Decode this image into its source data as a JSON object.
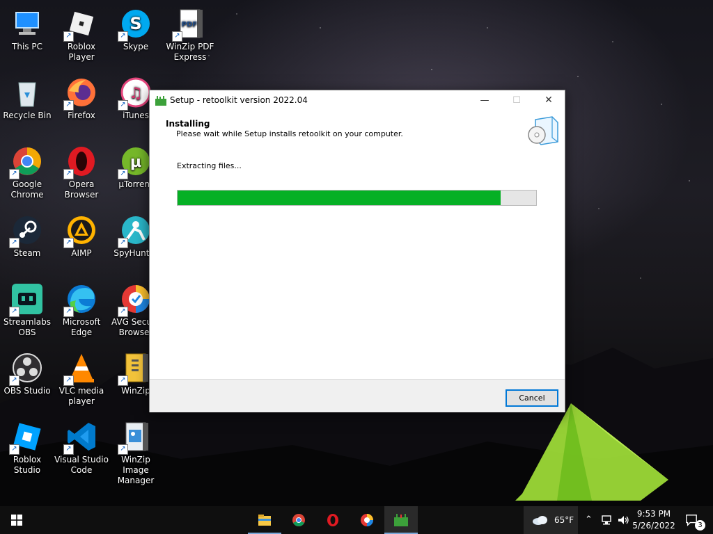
{
  "desktop": {
    "icons": [
      {
        "label": "This PC",
        "icon": "computer-icon"
      },
      {
        "label": "Roblox Player",
        "icon": "roblox-icon"
      },
      {
        "label": "Skype",
        "icon": "skype-icon"
      },
      {
        "label": "WinZip PDF Express",
        "icon": "winzip-pdf-icon"
      },
      {
        "label": "Recycle Bin",
        "icon": "recycle-bin-icon"
      },
      {
        "label": "Firefox",
        "icon": "firefox-icon"
      },
      {
        "label": "iTunes",
        "icon": "itunes-icon"
      },
      {
        "label": "Google Chrome",
        "icon": "chrome-icon"
      },
      {
        "label": "Opera Browser",
        "icon": "opera-icon"
      },
      {
        "label": "µTorrent",
        "icon": "utorrent-icon"
      },
      {
        "label": "Steam",
        "icon": "steam-icon"
      },
      {
        "label": "AIMP",
        "icon": "aimp-icon"
      },
      {
        "label": "SpyHunter",
        "icon": "spyhunter-icon"
      },
      {
        "label": "Streamlabs OBS",
        "icon": "streamlabs-icon"
      },
      {
        "label": "Microsoft Edge",
        "icon": "edge-icon"
      },
      {
        "label": "AVG Secure Browser",
        "icon": "avg-browser-icon"
      },
      {
        "label": "OBS Studio",
        "icon": "obs-icon"
      },
      {
        "label": "VLC media player",
        "icon": "vlc-icon"
      },
      {
        "label": "WinZip",
        "icon": "winzip-icon"
      },
      {
        "label": "Roblox Studio",
        "icon": "roblox-studio-icon"
      },
      {
        "label": "Visual Studio Code",
        "icon": "vscode-icon"
      },
      {
        "label": "WinZip Image Manager",
        "icon": "winzip-image-icon"
      }
    ]
  },
  "dialog": {
    "title": "Setup - retoolkit version 2022.04",
    "heading": "Installing",
    "subheading": "Please wait while Setup installs retoolkit on your computer.",
    "status": "Extracting files...",
    "progress": 0.9,
    "cancel_label": "Cancel",
    "minimize_glyph": "—",
    "maximize_glyph": "☐",
    "close_glyph": "✕"
  },
  "taskbar": {
    "apps": [
      "file-explorer-icon",
      "chrome-icon",
      "opera-icon",
      "avg-browser-icon",
      "setup-icon"
    ],
    "weather": "65°F",
    "time": "9:53 PM",
    "date": "5/26/2022",
    "notifications": "3"
  },
  "colors": {
    "progress_fill": "#06b025",
    "accent": "#0078d7"
  }
}
